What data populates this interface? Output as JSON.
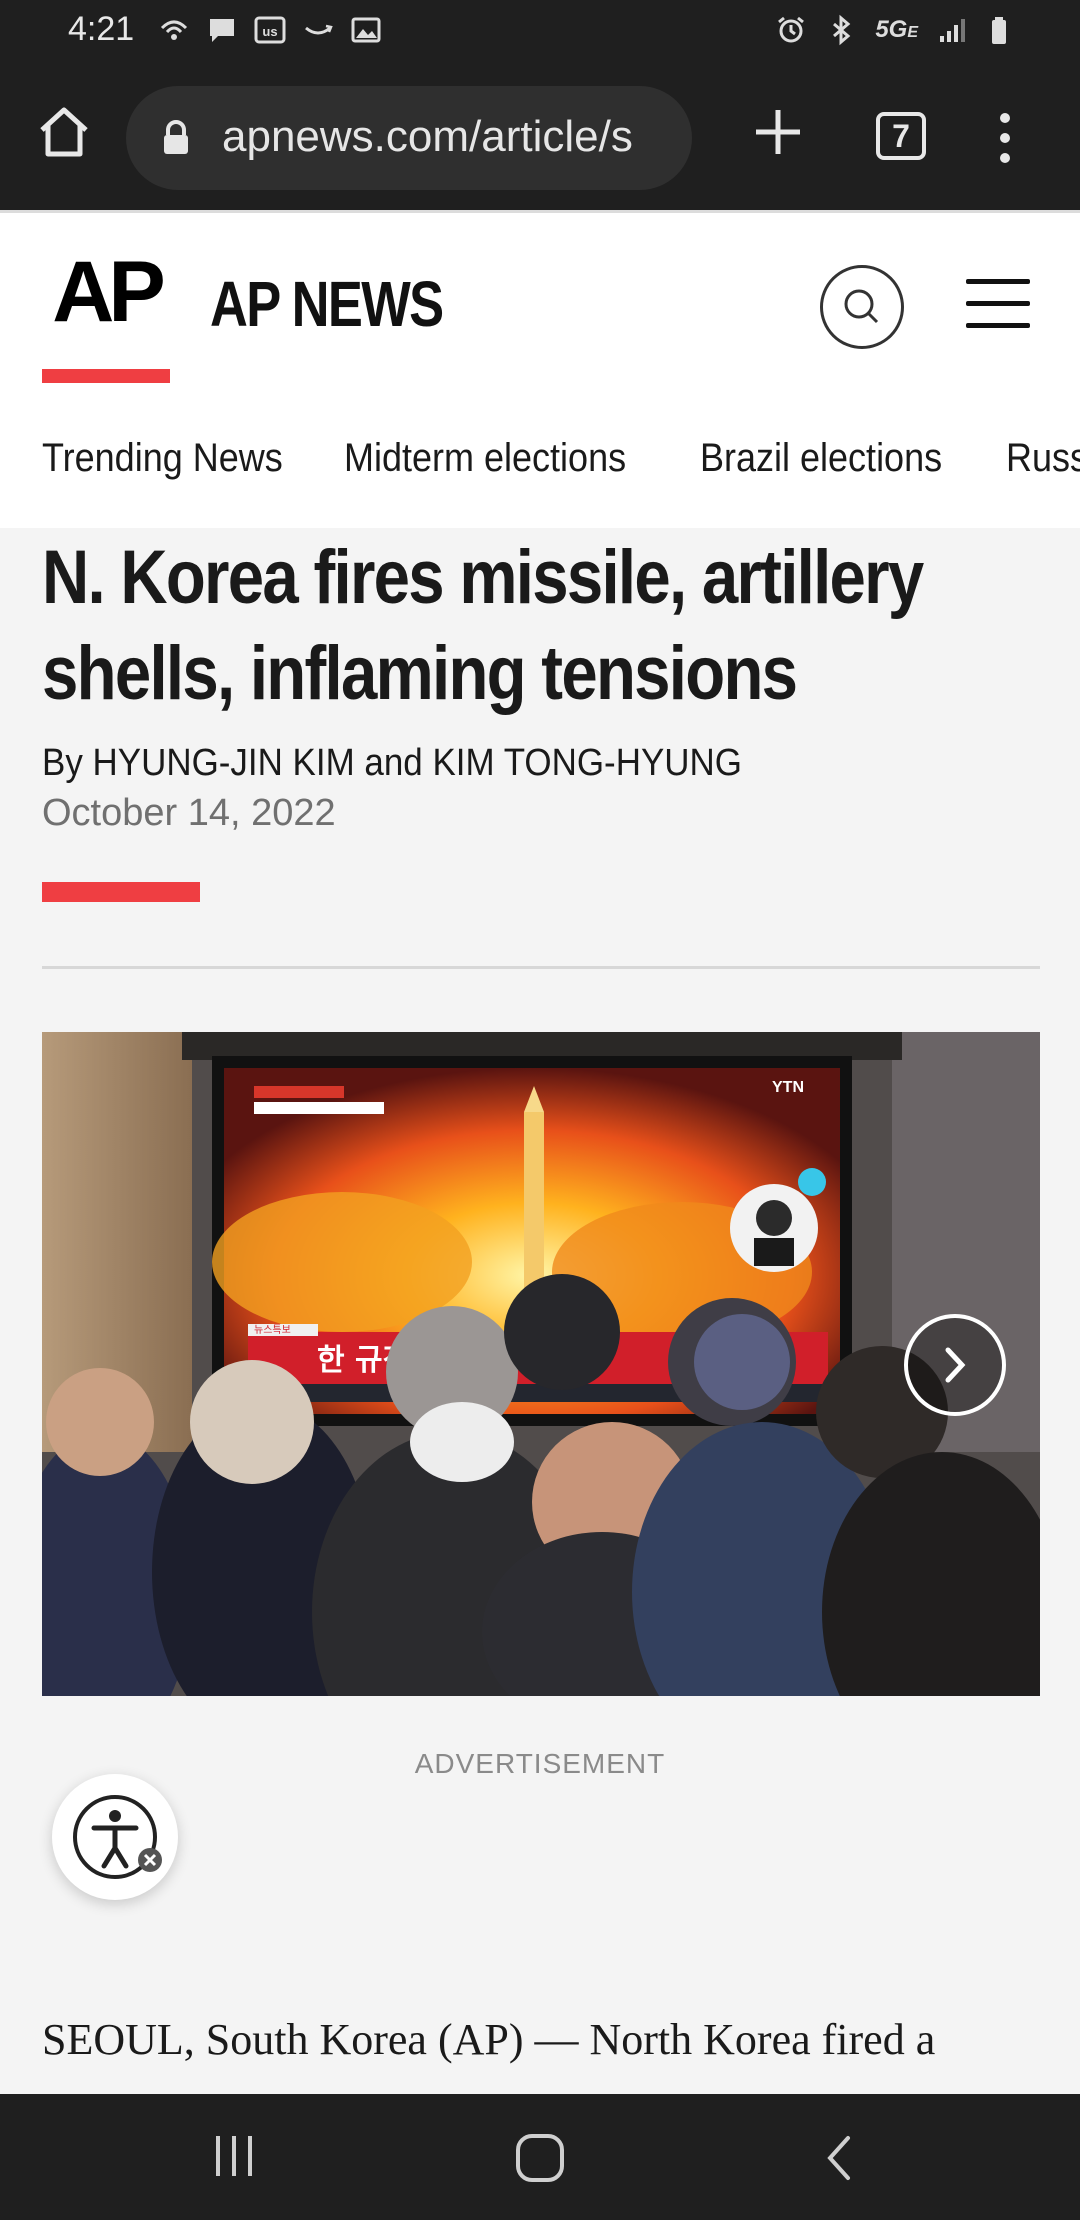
{
  "status_bar": {
    "time": "4:21",
    "network": "5G",
    "network_suffix": "E",
    "icons": [
      "wifi-calling-icon",
      "message-icon",
      "usnews-app-icon",
      "amazon-icon",
      "image-icon",
      "alarm-icon",
      "bluetooth-icon",
      "signal-icon",
      "battery-icon"
    ]
  },
  "browser": {
    "url": "apnews.com/article/s",
    "tab_count": "7"
  },
  "site": {
    "logo_text": "AP",
    "name": "AP NEWS",
    "brand_red": "#ef3e42"
  },
  "nav": {
    "items": [
      "Trending News",
      "Midterm elections",
      "Brazil elections",
      "Russ"
    ]
  },
  "article": {
    "headline": "N. Korea fires missile, artillery shells, inflaming tensions",
    "byline": "By HYUNG-JIN KIM and KIM TONG-HYUNG",
    "date": "October 14, 2022",
    "ad_label": "ADVERTISEMENT",
    "body_start": "SEOUL, South Korea (AP) — North Korea fired a"
  },
  "photo": {
    "tv_channel": "YTN",
    "tv_banner": "한 규정 세 번째 사례",
    "tv_label": "뉴스특보"
  }
}
